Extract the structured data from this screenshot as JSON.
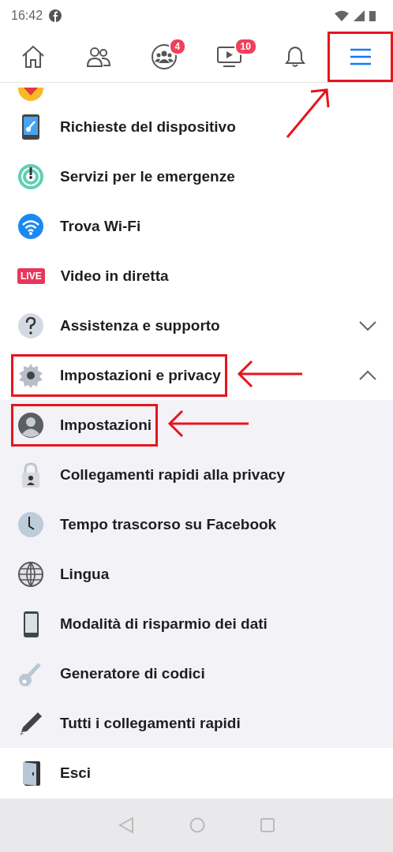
{
  "status_bar": {
    "time": "16:42"
  },
  "tabs": [
    {
      "kind": "home",
      "selected": false
    },
    {
      "kind": "friends",
      "selected": false
    },
    {
      "kind": "groups",
      "selected": false,
      "badge": "4"
    },
    {
      "kind": "watch",
      "selected": false,
      "badge": "10"
    },
    {
      "kind": "notifications",
      "selected": false
    },
    {
      "kind": "menu",
      "selected": true,
      "highlighted": true
    }
  ],
  "cut_off_item": {
    "kind": "fundraiser"
  },
  "menu_items": [
    {
      "kind": "device",
      "label": "Richieste del dispositivo"
    },
    {
      "kind": "emergency",
      "label": "Servizi per le emergenze"
    },
    {
      "kind": "wifi",
      "label": "Trova Wi-Fi"
    },
    {
      "kind": "live",
      "label": "Video in diretta",
      "icon_text": "LIVE"
    },
    {
      "kind": "help",
      "label": "Assistenza e supporto",
      "expanded": false
    },
    {
      "kind": "gear",
      "label": "Impostazioni e privacy",
      "expanded": true,
      "highlighted": true,
      "children": [
        {
          "kind": "avatar",
          "label": "Impostazioni",
          "highlighted": true
        },
        {
          "kind": "lock",
          "label": "Collegamenti rapidi alla privacy"
        },
        {
          "kind": "clock",
          "label": "Tempo trascorso su Facebook"
        },
        {
          "kind": "globe",
          "label": "Lingua"
        },
        {
          "kind": "phone",
          "label": "Modalità di risparmio dei dati"
        },
        {
          "kind": "key",
          "label": "Generatore di codici"
        },
        {
          "kind": "pencil",
          "label": "Tutti i collegamenti rapidi"
        }
      ]
    },
    {
      "kind": "door",
      "label": "Esci"
    }
  ]
}
